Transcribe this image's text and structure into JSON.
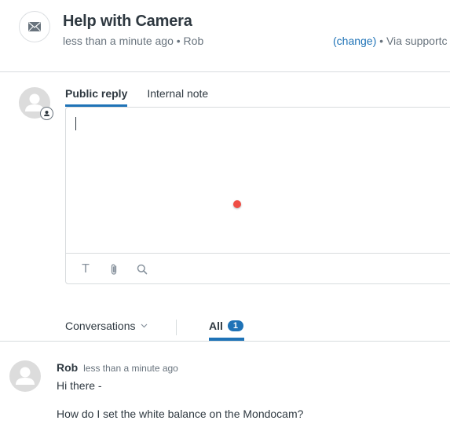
{
  "ticket": {
    "icon": "envelope-icon",
    "title": "Help with Camera",
    "meta": "less than a minute ago • Rob",
    "change_link": "(change)",
    "via": " • Via supportc"
  },
  "composer": {
    "avatar_icon": "user-avatar-icon",
    "badge_icon": "agent-badge-icon",
    "tabs": [
      {
        "label": "Public reply",
        "active": true
      },
      {
        "label": "Internal note",
        "active": false
      }
    ],
    "input_value": "",
    "toolbar": [
      {
        "icon": "text-format-icon",
        "glyph": "T"
      },
      {
        "icon": "paperclip-icon"
      },
      {
        "icon": "search-icon"
      }
    ]
  },
  "filter": {
    "dropdown_label": "Conversations",
    "all_label": "All",
    "all_count": "1"
  },
  "messages": [
    {
      "author": "Rob",
      "time": "less than a minute ago",
      "line1": "Hi there -",
      "line2": "How do I set the white balance on the Mondocam?"
    }
  ],
  "colors": {
    "accent": "#1f73b7",
    "text": "#2f3941",
    "muted": "#68737d",
    "border": "#d8dcde",
    "cursor_dot": "#ef4d45"
  }
}
